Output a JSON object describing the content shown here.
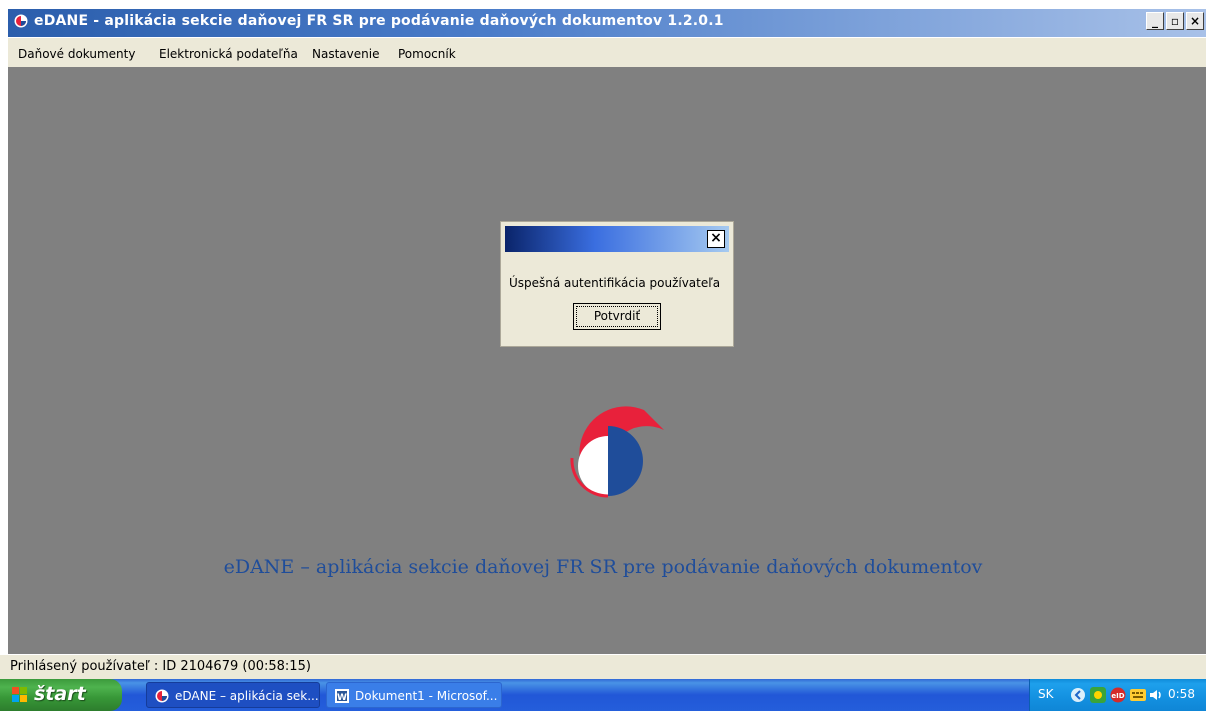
{
  "window": {
    "title": "eDANE - aplikácia sekcie daňovej FR SR pre podávanie daňových dokumentov  1.2.0.1",
    "minimize_label": "_",
    "restore_label": "▫",
    "close_label": "×"
  },
  "menu": {
    "items": [
      "Daňové dokumenty",
      "Elektronická podateľňa",
      "Nastavenie",
      "Pomocník"
    ]
  },
  "dialog": {
    "close_label": "×",
    "message": "Úspešná autentifikácia používateľa",
    "confirm_label": "Potvrdiť"
  },
  "tagline": "eDANE – aplikácia sekcie daňovej FR SR pre podávanie daňových dokumentov",
  "status": {
    "text": "Prihlásený používateľ : ID 2104679    (00:58:15)"
  },
  "taskbar": {
    "start_label": "štart",
    "tasks": [
      "eDANE – aplikácia sek...",
      "Dokument1 - Microsof..."
    ],
    "tray_language": "SK",
    "tray_time": "0:58"
  },
  "colors": {
    "accent_blue": "#1f4d9a",
    "logo_red": "#e8213b",
    "logo_blue": "#1f4d9a"
  }
}
